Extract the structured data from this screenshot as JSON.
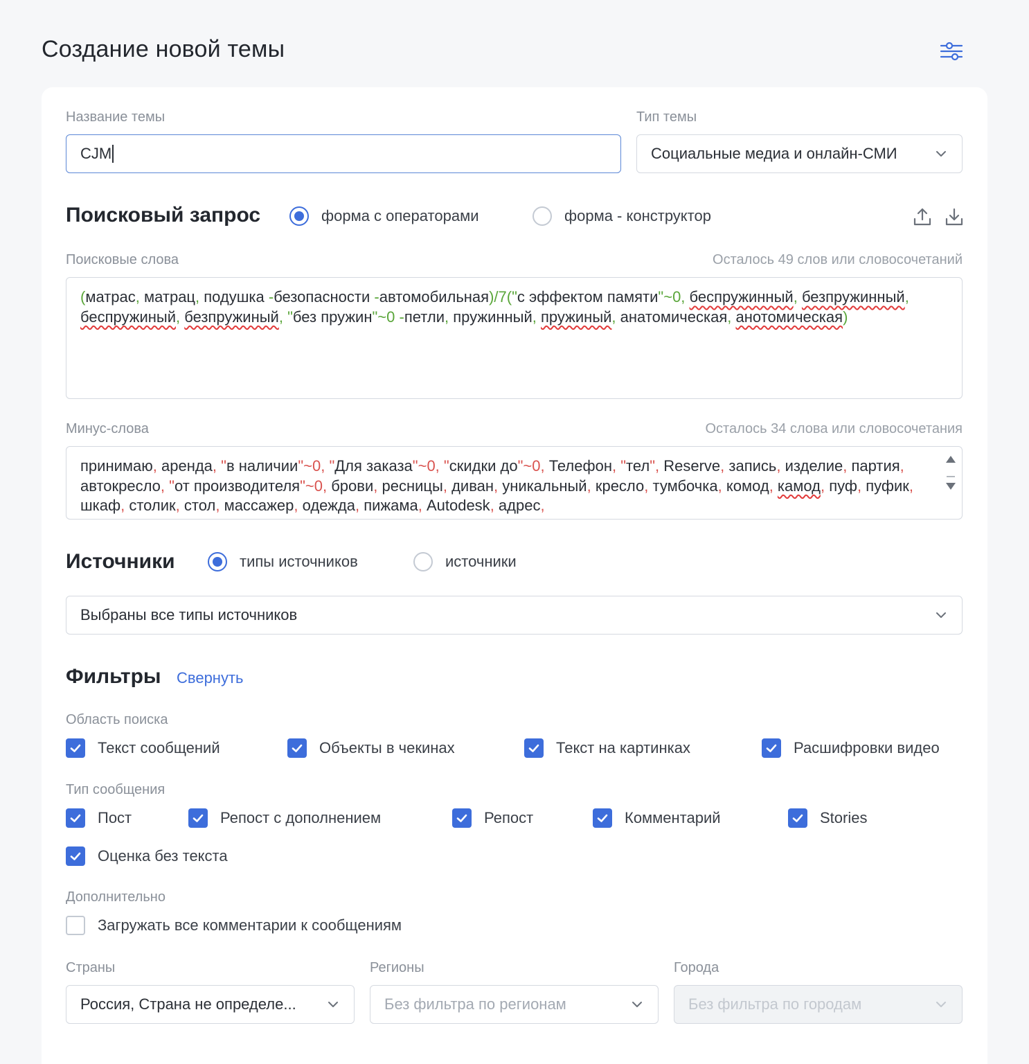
{
  "page": {
    "title": "Создание новой темы",
    "settings_icon": "sliders-icon"
  },
  "theme": {
    "name_label": "Название темы",
    "name_value": "CJM",
    "type_label": "Тип темы",
    "type_value": "Социальные медиа и онлайн-СМИ"
  },
  "search": {
    "title": "Поисковый запрос",
    "mode_operators": "форма с операторами",
    "mode_builder": "форма - конструктор",
    "selected_mode": "operators",
    "keywords_label": "Поисковые слова",
    "keywords_hint": "Осталось 49 слов или словосочетаний",
    "keywords_tokens": [
      {
        "t": "(",
        "c": "g"
      },
      {
        "t": "матрас"
      },
      {
        "t": ", ",
        "c": "g"
      },
      {
        "t": "матрац"
      },
      {
        "t": ", ",
        "c": "g"
      },
      {
        "t": "подушка "
      },
      {
        "t": "-",
        "c": "g"
      },
      {
        "t": "безопасности "
      },
      {
        "t": "-",
        "c": "g"
      },
      {
        "t": "автомобильная"
      },
      {
        "t": ")/7(\"",
        "c": "g"
      },
      {
        "t": "с эффектом памяти"
      },
      {
        "t": "\"~0, ",
        "c": "g"
      },
      {
        "t": "беспружинный",
        "s": true
      },
      {
        "t": ",",
        "c": "g"
      },
      {
        "t": " "
      },
      {
        "t": "безпружинный",
        "s": true
      },
      {
        "t": ", ",
        "c": "g"
      },
      {
        "t": "беспружиный",
        "s": true
      },
      {
        "t": ", ",
        "c": "g"
      },
      {
        "t": "безпружиный",
        "s": true
      },
      {
        "t": ",  \"",
        "c": "g"
      },
      {
        "t": "без пружин"
      },
      {
        "t": "\"~0 -",
        "c": "g"
      },
      {
        "t": "петли"
      },
      {
        "t": ", ",
        "c": "g"
      },
      {
        "t": "пружинный"
      },
      {
        "t": ", ",
        "c": "g"
      },
      {
        "t": "пружиный",
        "s": true
      },
      {
        "t": ",",
        "c": "g"
      },
      {
        "t": " "
      },
      {
        "t": "анатомическая"
      },
      {
        "t": ", ",
        "c": "g"
      },
      {
        "t": "анотомическая",
        "s": true
      },
      {
        "t": ")",
        "c": "g"
      }
    ],
    "minus_label": "Минус-слова",
    "minus_hint": "Осталось 34 слова или словосочетания",
    "minus_tokens": [
      {
        "t": "принимаю"
      },
      {
        "t": ", ",
        "c": "r"
      },
      {
        "t": "аренда"
      },
      {
        "t": ", \"",
        "c": "r"
      },
      {
        "t": "в наличии"
      },
      {
        "t": "\"~0, \"",
        "c": "r"
      },
      {
        "t": "Для заказа"
      },
      {
        "t": "\"~0, \"",
        "c": "r"
      },
      {
        "t": "скидки до"
      },
      {
        "t": "\"~0, ",
        "c": "r"
      },
      {
        "t": "Телефон"
      },
      {
        "t": ", \"",
        "c": "r"
      },
      {
        "t": "тел"
      },
      {
        "t": "\", ",
        "c": "r"
      },
      {
        "t": "Reserve"
      },
      {
        "t": ", ",
        "c": "r"
      },
      {
        "t": "запись"
      },
      {
        "t": ",",
        "c": "r"
      },
      {
        "t": " "
      },
      {
        "t": "изделие"
      },
      {
        "t": ", ",
        "c": "r"
      },
      {
        "t": "партия"
      },
      {
        "t": ", ",
        "c": "r"
      },
      {
        "t": "автокресло"
      },
      {
        "t": ", \"",
        "c": "r"
      },
      {
        "t": "от производителя"
      },
      {
        "t": "\"~0, ",
        "c": "r"
      },
      {
        "t": "брови"
      },
      {
        "t": ", ",
        "c": "r"
      },
      {
        "t": "ресницы"
      },
      {
        "t": ", ",
        "c": "r"
      },
      {
        "t": "диван"
      },
      {
        "t": ", ",
        "c": "r"
      },
      {
        "t": "уникальный"
      },
      {
        "t": ", ",
        "c": "r"
      },
      {
        "t": "кресло"
      },
      {
        "t": ",",
        "c": "r"
      },
      {
        "t": " "
      },
      {
        "t": "тумбочка"
      },
      {
        "t": ", ",
        "c": "r"
      },
      {
        "t": "комод"
      },
      {
        "t": ", ",
        "c": "r"
      },
      {
        "t": "камод",
        "s": true
      },
      {
        "t": ", ",
        "c": "r"
      },
      {
        "t": "пуф"
      },
      {
        "t": ", ",
        "c": "r"
      },
      {
        "t": "пуфик"
      },
      {
        "t": ", ",
        "c": "r"
      },
      {
        "t": "шкаф"
      },
      {
        "t": ", ",
        "c": "r"
      },
      {
        "t": "столик"
      },
      {
        "t": ", ",
        "c": "r"
      },
      {
        "t": "стол"
      },
      {
        "t": ", ",
        "c": "r"
      },
      {
        "t": "массажер"
      },
      {
        "t": ", ",
        "c": "r"
      },
      {
        "t": "одежда"
      },
      {
        "t": ", ",
        "c": "r"
      },
      {
        "t": "пижама"
      },
      {
        "t": ", ",
        "c": "r"
      },
      {
        "t": "Autodesk"
      },
      {
        "t": ", ",
        "c": "r"
      },
      {
        "t": "адрес"
      },
      {
        "t": ",",
        "c": "r"
      }
    ],
    "upload_icon": "upload-icon",
    "download_icon": "download-icon"
  },
  "sources": {
    "title": "Источники",
    "mode_types": "типы источников",
    "mode_sources": "источники",
    "selected_mode": "types",
    "select_value": "Выбраны все типы источников"
  },
  "filters": {
    "title": "Фильтры",
    "collapse_link": "Свернуть",
    "scope_label": "Область поиска",
    "scope_items": [
      {
        "label": "Текст сообщений",
        "checked": true
      },
      {
        "label": "Объекты в чекинах",
        "checked": true
      },
      {
        "label": "Текст на картинках",
        "checked": true
      },
      {
        "label": "Расшифровки видео",
        "checked": true
      }
    ],
    "msgtype_label": "Тип сообщения",
    "msgtype_items": [
      {
        "label": "Пост",
        "checked": true
      },
      {
        "label": "Репост с дополнением",
        "checked": true
      },
      {
        "label": "Репост",
        "checked": true
      },
      {
        "label": "Комментарий",
        "checked": true
      },
      {
        "label": "Stories",
        "checked": true
      },
      {
        "label": "Оценка без текста",
        "checked": true
      }
    ],
    "extra_label": "Дополнительно",
    "extra_items": [
      {
        "label": "Загружать все комментарии к сообщениям",
        "checked": false
      }
    ],
    "countries_label": "Страны",
    "countries_value": "Россия, Страна не определе...",
    "regions_label": "Регионы",
    "regions_placeholder": "Без фильтра по регионам",
    "cities_label": "Города",
    "cities_placeholder": "Без фильтра по городам"
  },
  "colors": {
    "accent": "#3d6ddb",
    "operator_green": "#5aa63a",
    "operator_red": "#d9534f",
    "spell_error": "#e23b3b"
  }
}
